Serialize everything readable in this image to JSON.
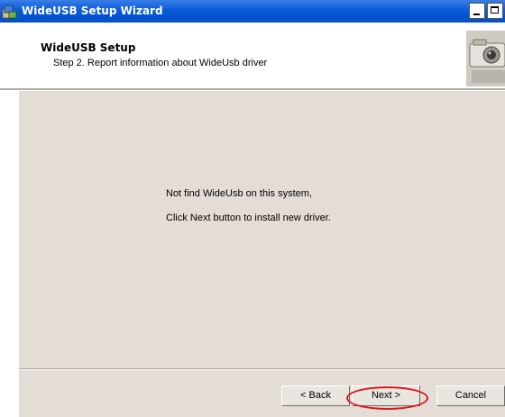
{
  "window": {
    "title": "WideUSB Setup Wizard",
    "icon": "setup-installer-icon"
  },
  "header": {
    "title": "WideUSB Setup",
    "subtitle": "Step 2. Report information about WideUsb driver",
    "image": "camera-graphic"
  },
  "content": {
    "line1": "Not find WideUsb on this system,",
    "line2": "Click Next button to install new driver."
  },
  "buttons": {
    "back": "< Back",
    "next": "Next >",
    "cancel": "Cancel"
  },
  "colors": {
    "titlebar": "#0a5bd8",
    "panel": "#e4ddd6",
    "highlight": "#e0141c"
  }
}
